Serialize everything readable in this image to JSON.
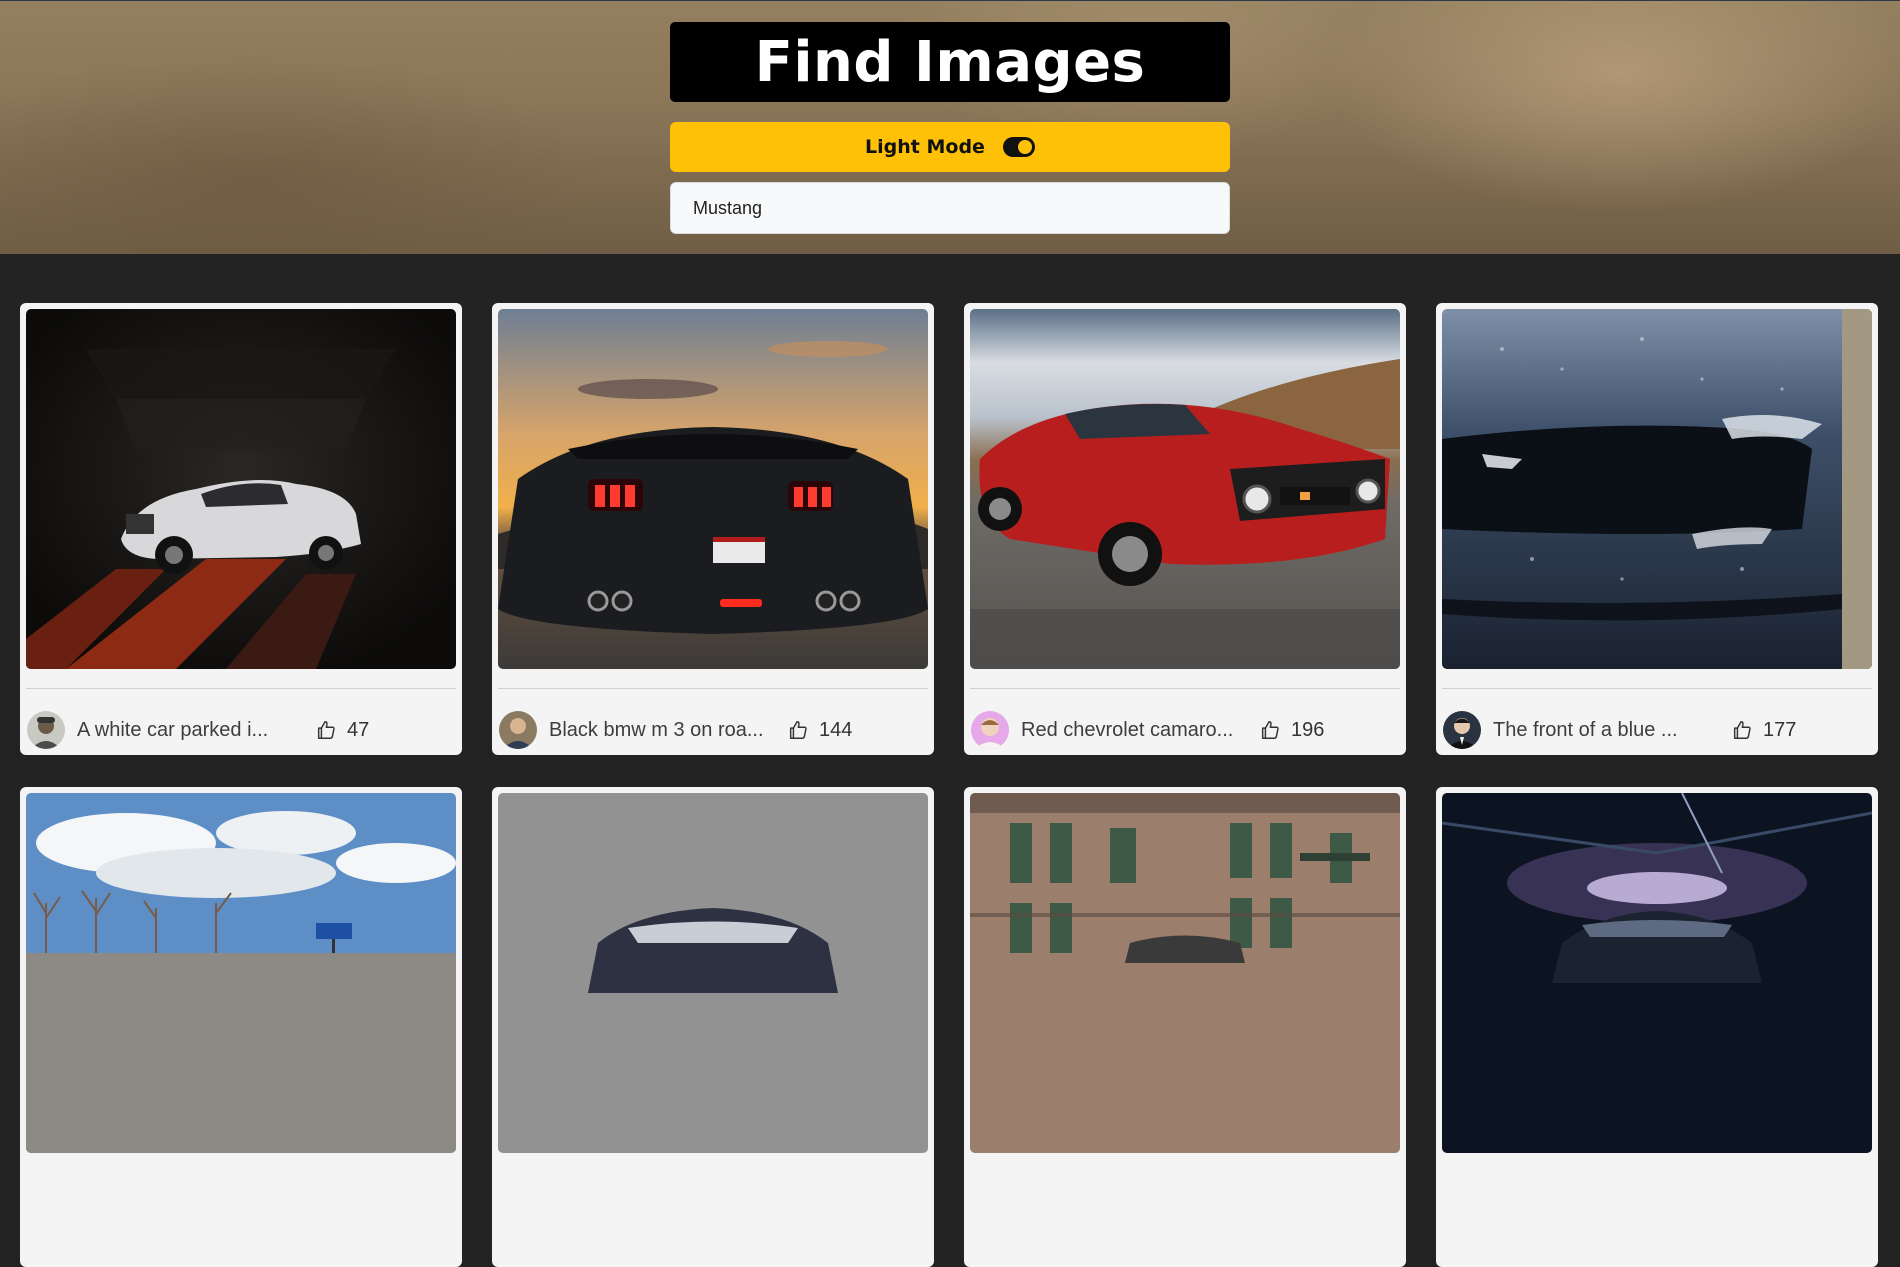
{
  "header": {
    "title": "Find Images",
    "mode_label": "Light Mode",
    "mode_toggle_on": true,
    "search_value": "Mustang"
  },
  "colors": {
    "accent": "#ffc107",
    "page_background": "#232323",
    "card_background": "#f4f4f5",
    "title_background": "#000000"
  },
  "cards": [
    {
      "caption": "A white car parked i...",
      "likes": "47",
      "image": "white-mustang-garage",
      "avatar": "user-avatar-cap"
    },
    {
      "caption": "Black bmw m 3 on roa...",
      "likes": "144",
      "image": "black-car-sunset-rear",
      "avatar": "user-avatar-man"
    },
    {
      "caption": "Red chevrolet camaro...",
      "likes": "196",
      "image": "red-classic-mustang",
      "avatar": "user-avatar-smiling"
    },
    {
      "caption": "The front of a blue ...",
      "likes": "177",
      "image": "blue-mustang-front-rain",
      "avatar": "user-avatar-suit"
    }
  ],
  "partial_cards": [
    {
      "image": "car-sky-trees"
    },
    {
      "image": "dark-car-grey-wall"
    },
    {
      "image": "old-building-car"
    },
    {
      "image": "car-dark-garage-lights"
    }
  ]
}
